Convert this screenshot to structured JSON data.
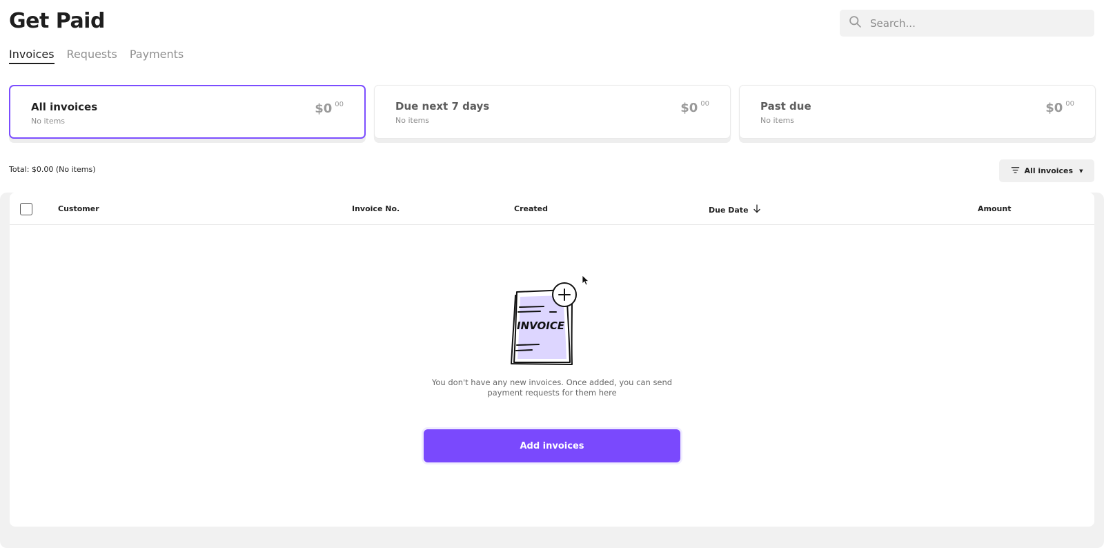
{
  "header": {
    "title": "Get Paid",
    "search_placeholder": "Search...",
    "search_icon": "search-icon"
  },
  "tabs": [
    {
      "label": "Invoices",
      "active": true
    },
    {
      "label": "Requests",
      "active": false
    },
    {
      "label": "Payments",
      "active": false
    }
  ],
  "cards": [
    {
      "title": "All invoices",
      "subtitle": "No items",
      "amount_main": "$0",
      "amount_cents": "00",
      "selected": true
    },
    {
      "title": "Due next 7 days",
      "subtitle": "No items",
      "amount_main": "$0",
      "amount_cents": "00",
      "selected": false
    },
    {
      "title": "Past due",
      "subtitle": "No items",
      "amount_main": "$0",
      "amount_cents": "00",
      "selected": false
    }
  ],
  "summary": {
    "total_text": "Total: $0.00 (No items)"
  },
  "filter": {
    "label": "All invoices",
    "icon": "filter-icon"
  },
  "table": {
    "columns": [
      "Customer",
      "Invoice No.",
      "Created",
      "Due Date",
      "Amount"
    ],
    "sort_column": "Due Date",
    "sort_direction": "descending"
  },
  "empty_state": {
    "illustration_text": "INVOICE",
    "message_line1": "You don't have any new invoices. Once added, you can send",
    "message_line2": "payment requests for them here",
    "button_label": "Add invoices"
  },
  "colors": {
    "accent": "#7a49fd",
    "selected_border": "#7b4dff",
    "illustration_fill": "#ddd6ff"
  }
}
